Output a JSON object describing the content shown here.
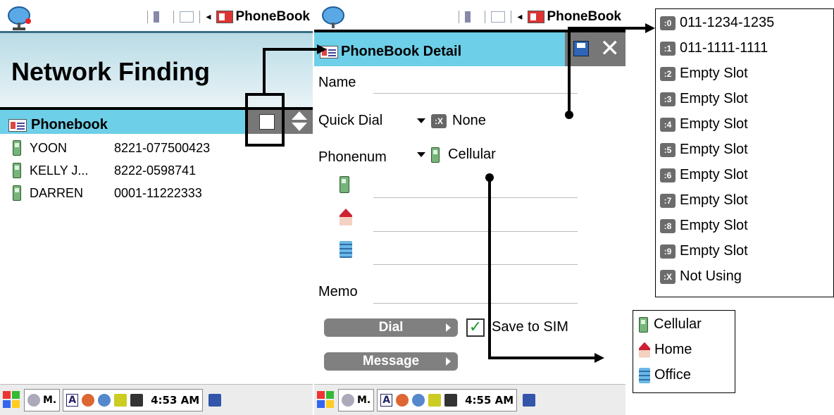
{
  "left_screen": {
    "app_title": "PhoneBook",
    "header_title": "Network Finding",
    "list_title": "Phonebook",
    "contacts": [
      {
        "name": "YOON",
        "number": "8221-077500423"
      },
      {
        "name": "KELLY J...",
        "number": "8222-0598741"
      },
      {
        "name": "DARREN",
        "number": "0001-11222333"
      }
    ],
    "taskbar": {
      "app_label": "M.",
      "clock": "4:53 AM"
    }
  },
  "right_screen": {
    "app_title": "PhoneBook",
    "detail_title": "PhoneBook Detail",
    "fields": {
      "name_label": "Name",
      "quick_dial_label": "Quick Dial",
      "quick_dial_value": "None",
      "quick_dial_badge": ":X",
      "phonenum_label": "Phonenum",
      "phonenum_value": "Cellular",
      "memo_label": "Memo"
    },
    "buttons": {
      "dial": "Dial",
      "message": "Message"
    },
    "save_to_sim": {
      "label": "Save to SIM",
      "checked": true
    },
    "taskbar": {
      "app_label": "M.",
      "clock": "4:55 AM"
    }
  },
  "quick_dial_popup": {
    "items": [
      {
        "badge": ":0",
        "label": "011-1234-1235"
      },
      {
        "badge": ":1",
        "label": "011-1111-1111"
      },
      {
        "badge": ":2",
        "label": "Empty Slot"
      },
      {
        "badge": ":3",
        "label": "Empty Slot"
      },
      {
        "badge": ":4",
        "label": "Empty Slot"
      },
      {
        "badge": ":5",
        "label": "Empty Slot"
      },
      {
        "badge": ":6",
        "label": "Empty Slot"
      },
      {
        "badge": ":7",
        "label": "Empty Slot"
      },
      {
        "badge": ":8",
        "label": "Empty Slot"
      },
      {
        "badge": ":9",
        "label": "Empty Slot"
      },
      {
        "badge": ":X",
        "label": "Not Using"
      }
    ]
  },
  "phone_type_popup": {
    "items": [
      {
        "icon": "cellular-icon",
        "label": "Cellular"
      },
      {
        "icon": "home-icon",
        "label": "Home"
      },
      {
        "icon": "office-icon",
        "label": "Office"
      }
    ]
  }
}
